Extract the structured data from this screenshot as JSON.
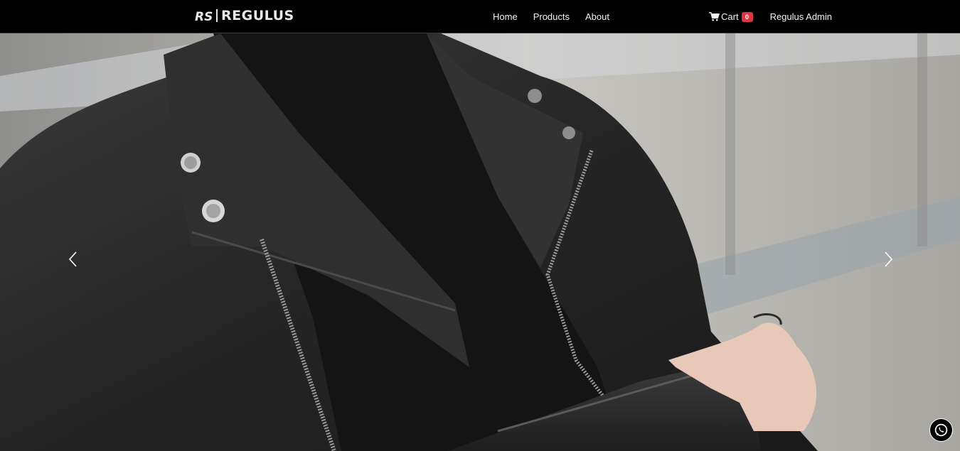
{
  "brand": {
    "name": "REGULUS",
    "mark": "RS",
    "color": "#e9e9e9"
  },
  "nav": {
    "links": [
      {
        "label": "Home"
      },
      {
        "label": "Products"
      },
      {
        "label": "About"
      }
    ],
    "cart": {
      "icon": "shopping-cart-icon",
      "label": "Cart",
      "count": "0",
      "badge_color": "#dc3545"
    },
    "user": {
      "label": "Regulus Admin"
    }
  },
  "carousel": {
    "prev_icon": "chevron-left-icon",
    "next_icon": "chevron-right-icon"
  },
  "chat": {
    "icon": "whatsapp-icon"
  },
  "colors": {
    "navbar_bg": "#000000",
    "nav_text": "#f2f2f2"
  }
}
